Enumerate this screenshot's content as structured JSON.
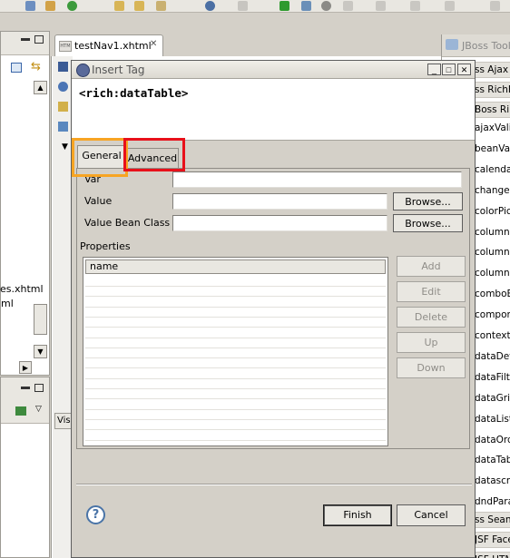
{
  "editor": {
    "tab_label": "testNav1.xhtml",
    "tab_close": "✕",
    "left_file_1": "es.xhtml",
    "left_file_2": "ml",
    "visual_tab_label": "Vis"
  },
  "palette": {
    "header": "JBoss Tools",
    "groups": [
      "ss Ajax",
      "ss RichF",
      "Boss Ri"
    ],
    "items": [
      "ajaxValid",
      "beanVali",
      "calendar",
      "changeB",
      "colorPick",
      "column",
      "columnG",
      "columns",
      "comboBo",
      "compone",
      "context",
      "dataDef",
      "dataFilte",
      "dataGrid",
      "dataList",
      "dataOrd",
      "dataTab",
      "datascro",
      "dndPara"
    ],
    "footer_groups": [
      "ss Sean",
      "JSF Facelet",
      "JSF HTML"
    ]
  },
  "dialog": {
    "title": "Insert Tag",
    "min_glyph": "_",
    "max_glyph": "□",
    "close_glyph": "✕",
    "tag_text": "<rich:dataTable>",
    "tabs": [
      {
        "label": "General",
        "selected": true
      },
      {
        "label": "Advanced",
        "selected": false
      }
    ],
    "highlight_colors": {
      "general": "#f7a423",
      "advanced": "#e8101a"
    },
    "fields": {
      "var_label": "Var",
      "value_label": "Value",
      "value_bean_class_label": "Value Bean Class",
      "browse_label": "Browse..."
    },
    "properties": {
      "label": "Properties",
      "column_header": "name",
      "buttons": {
        "add": "Add",
        "edit": "Edit",
        "delete": "Delete",
        "up": "Up",
        "down": "Down"
      }
    },
    "footer": {
      "help_glyph": "?",
      "finish_label": "Finish",
      "cancel_label": "Cancel"
    }
  }
}
